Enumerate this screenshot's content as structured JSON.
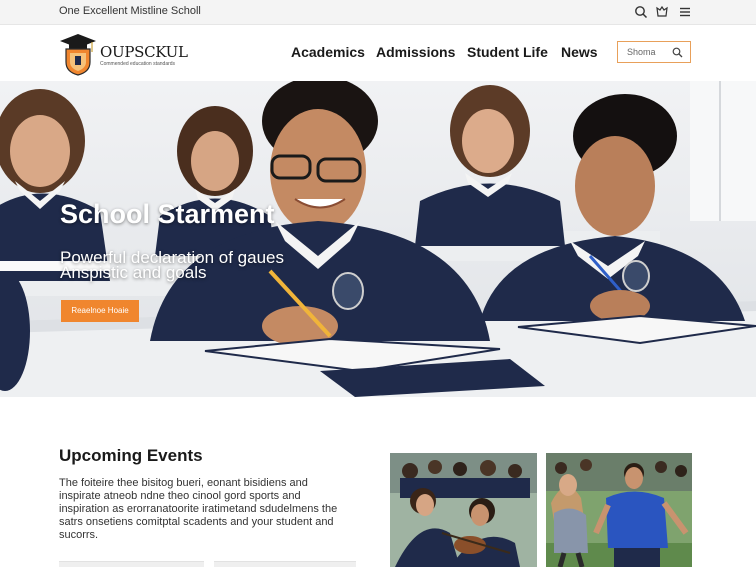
{
  "topbar": {
    "motto": "One Excellent Mistline Scholl",
    "icons": [
      "search-icon",
      "user-icon",
      "menu-icon"
    ]
  },
  "header": {
    "logo_name": "OUPSCKUL",
    "logo_tagline": "Commended education standards",
    "nav": [
      {
        "label": "Academics"
      },
      {
        "label": "Admissions"
      },
      {
        "label": "Student Life"
      },
      {
        "label": "News"
      }
    ],
    "search_placeholder": "Shoma"
  },
  "hero": {
    "title": "School Starment",
    "subtitle_line1": "Powerful declaration of gaues",
    "subtitle_line2": "Anspistic and goals",
    "button_label": "Reaelnoe Hoaie"
  },
  "events": {
    "title": "Upcoming Events",
    "body": "The foiteire thee bisitog bueri, eonant bisidiens and inspirate atneob ndne theo cinool gord sports and inspiration as erorranatoorite iratimetand sdudelmens the satrs onsetiens comitptal scadents and your student and sucorrs."
  },
  "colors": {
    "accent": "#f0862e",
    "navy": "#1f2a4a"
  }
}
